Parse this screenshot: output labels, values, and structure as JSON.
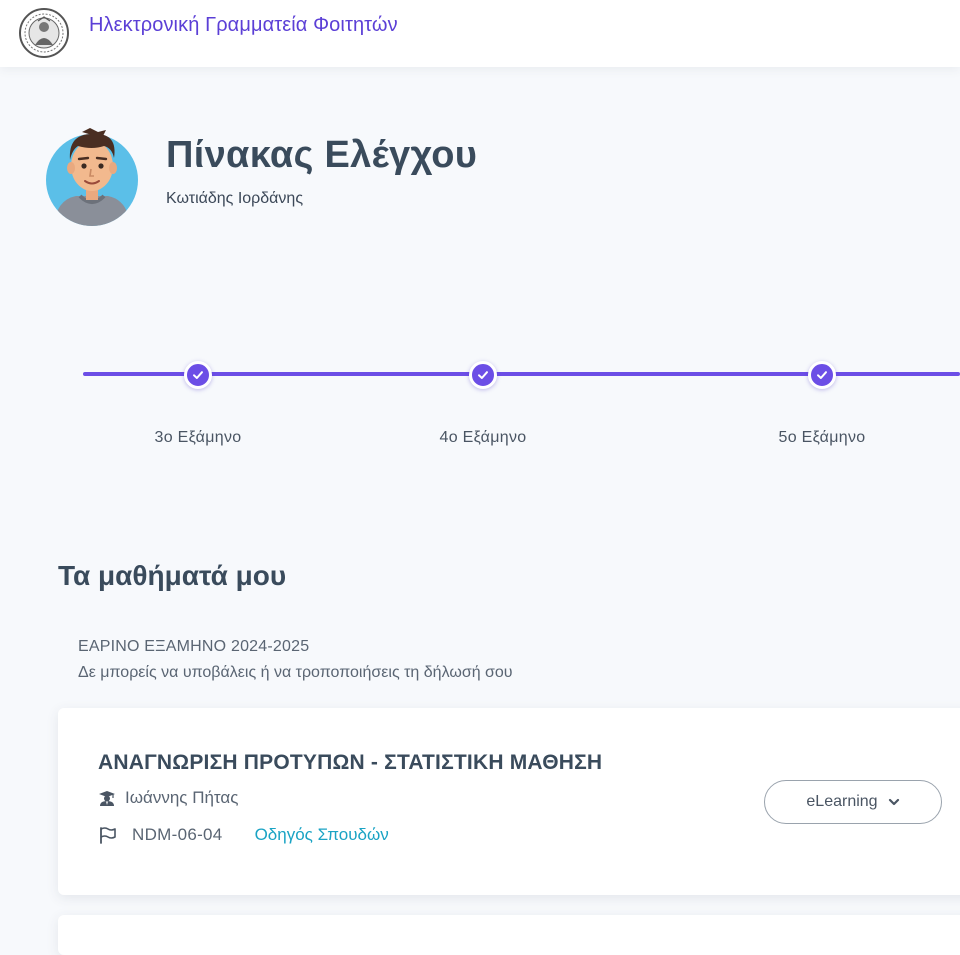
{
  "header": {
    "app_title": "Ηλεκτρονική Γραμματεία Φοιτητών",
    "logo_icon": "university-seal-icon"
  },
  "profile": {
    "page_title": "Πίνακας Ελέγχου",
    "user_name": "Κωτιάδης Ιορδάνης",
    "avatar_icon": "student-avatar-icon"
  },
  "timeline": {
    "accent_color": "#6c4ee6",
    "semesters": [
      {
        "label": "3ο  Εξάμηνο",
        "completed": true
      },
      {
        "label": "4ο  Εξάμηνο",
        "completed": true
      },
      {
        "label": "5ο  Εξάμηνο",
        "completed": true
      }
    ]
  },
  "courses": {
    "section_title": "Τα μαθήματά μου",
    "semester_title": "ΕΑΡΙΝΟ ΕΞΑΜΗΝΟ 2024-2025",
    "semester_note": "Δε μπορείς να υποβάλεις ή να τροποποιήσεις τη δήλωσή σου",
    "items": [
      {
        "title": "ΑΝΑΓΝΩΡΙΣΗ ΠΡΟΤΥΠΩΝ - ΣΤΑΤΙΣΤΙΚΗ ΜΑΘΗΣΗ",
        "teacher": "Ιωάννης Πήτας",
        "teacher_icon": "graduation-cap-teacher-icon",
        "code": "NDM-06-04",
        "code_icon": "flag-icon",
        "guide_link": "Οδηγός Σπουδών",
        "elearning_label": "eLearning",
        "elearning_icon": "chevron-down-icon"
      }
    ]
  }
}
